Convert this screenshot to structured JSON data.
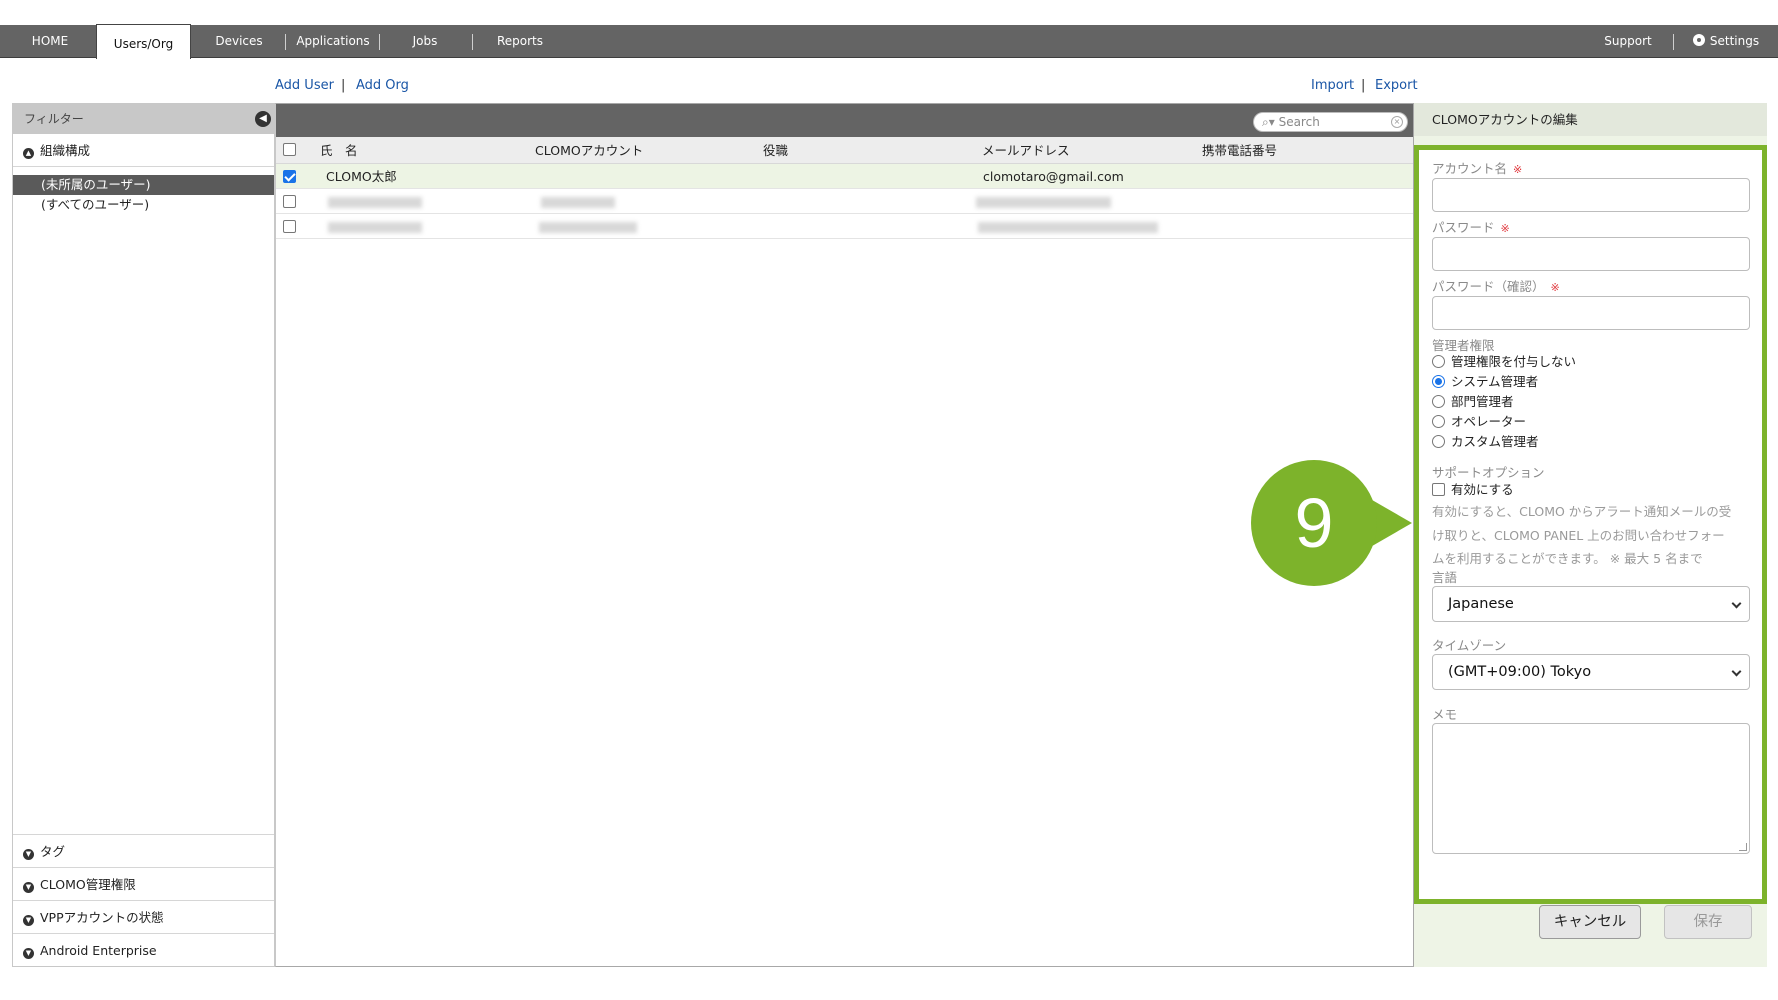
{
  "nav": {
    "tabs": [
      {
        "label": "HOME"
      },
      {
        "label": "Users/Org"
      },
      {
        "label": "Devices"
      },
      {
        "label": "Applications"
      },
      {
        "label": "Jobs"
      },
      {
        "label": "Reports"
      }
    ],
    "support": "Support",
    "settings": "Settings"
  },
  "actions": {
    "add_user": "Add User",
    "add_org": "Add Org",
    "import": "Import",
    "export": "Export",
    "sep": "|"
  },
  "filter": {
    "title": "フィルター",
    "org_section": "組織構成",
    "tree": [
      "(未所属のユーザー)",
      "(すべてのユーザー)"
    ],
    "bottom_sections": [
      "タグ",
      "CLOMO管理権限",
      "VPPアカウントの状態",
      "Android Enterprise"
    ]
  },
  "list": {
    "search_placeholder": "Search",
    "columns": [
      "氏　名",
      "CLOMOアカウント",
      "役職",
      "メールアドレス",
      "携帯電話番号"
    ],
    "rows": [
      {
        "name": "CLOMO太郎",
        "email": "clomotaro@gmail.com",
        "checked": true
      }
    ]
  },
  "edit": {
    "title": "CLOMOアカウントの編集",
    "account_label": "アカウント名",
    "password_label": "パスワード",
    "password_confirm_label": "パスワード（確認）",
    "required_mark": "※",
    "admin_label": "管理者権限",
    "admin_options": [
      "管理権限を付与しない",
      "システム管理者",
      "部門管理者",
      "オペレーター",
      "カスタム管理者"
    ],
    "admin_selected": 1,
    "support_label": "サポートオプション",
    "support_enable": "有効にする",
    "support_note_lines": [
      "有効にすると、CLOMO からアラート通知メールの受",
      "け取りと、CLOMO PANEL 上のお問い合わせフォー",
      "ムを利用することができます。 ※ 最大 5 名まで"
    ],
    "language_label": "言語",
    "language_value": "Japanese",
    "timezone_label": "タイムゾーン",
    "timezone_value": "(GMT+09:00) Tokyo",
    "memo_label": "メモ",
    "cancel": "キャンセル",
    "save": "保存"
  },
  "marker": {
    "number": "9",
    "color": "#7db32b"
  }
}
